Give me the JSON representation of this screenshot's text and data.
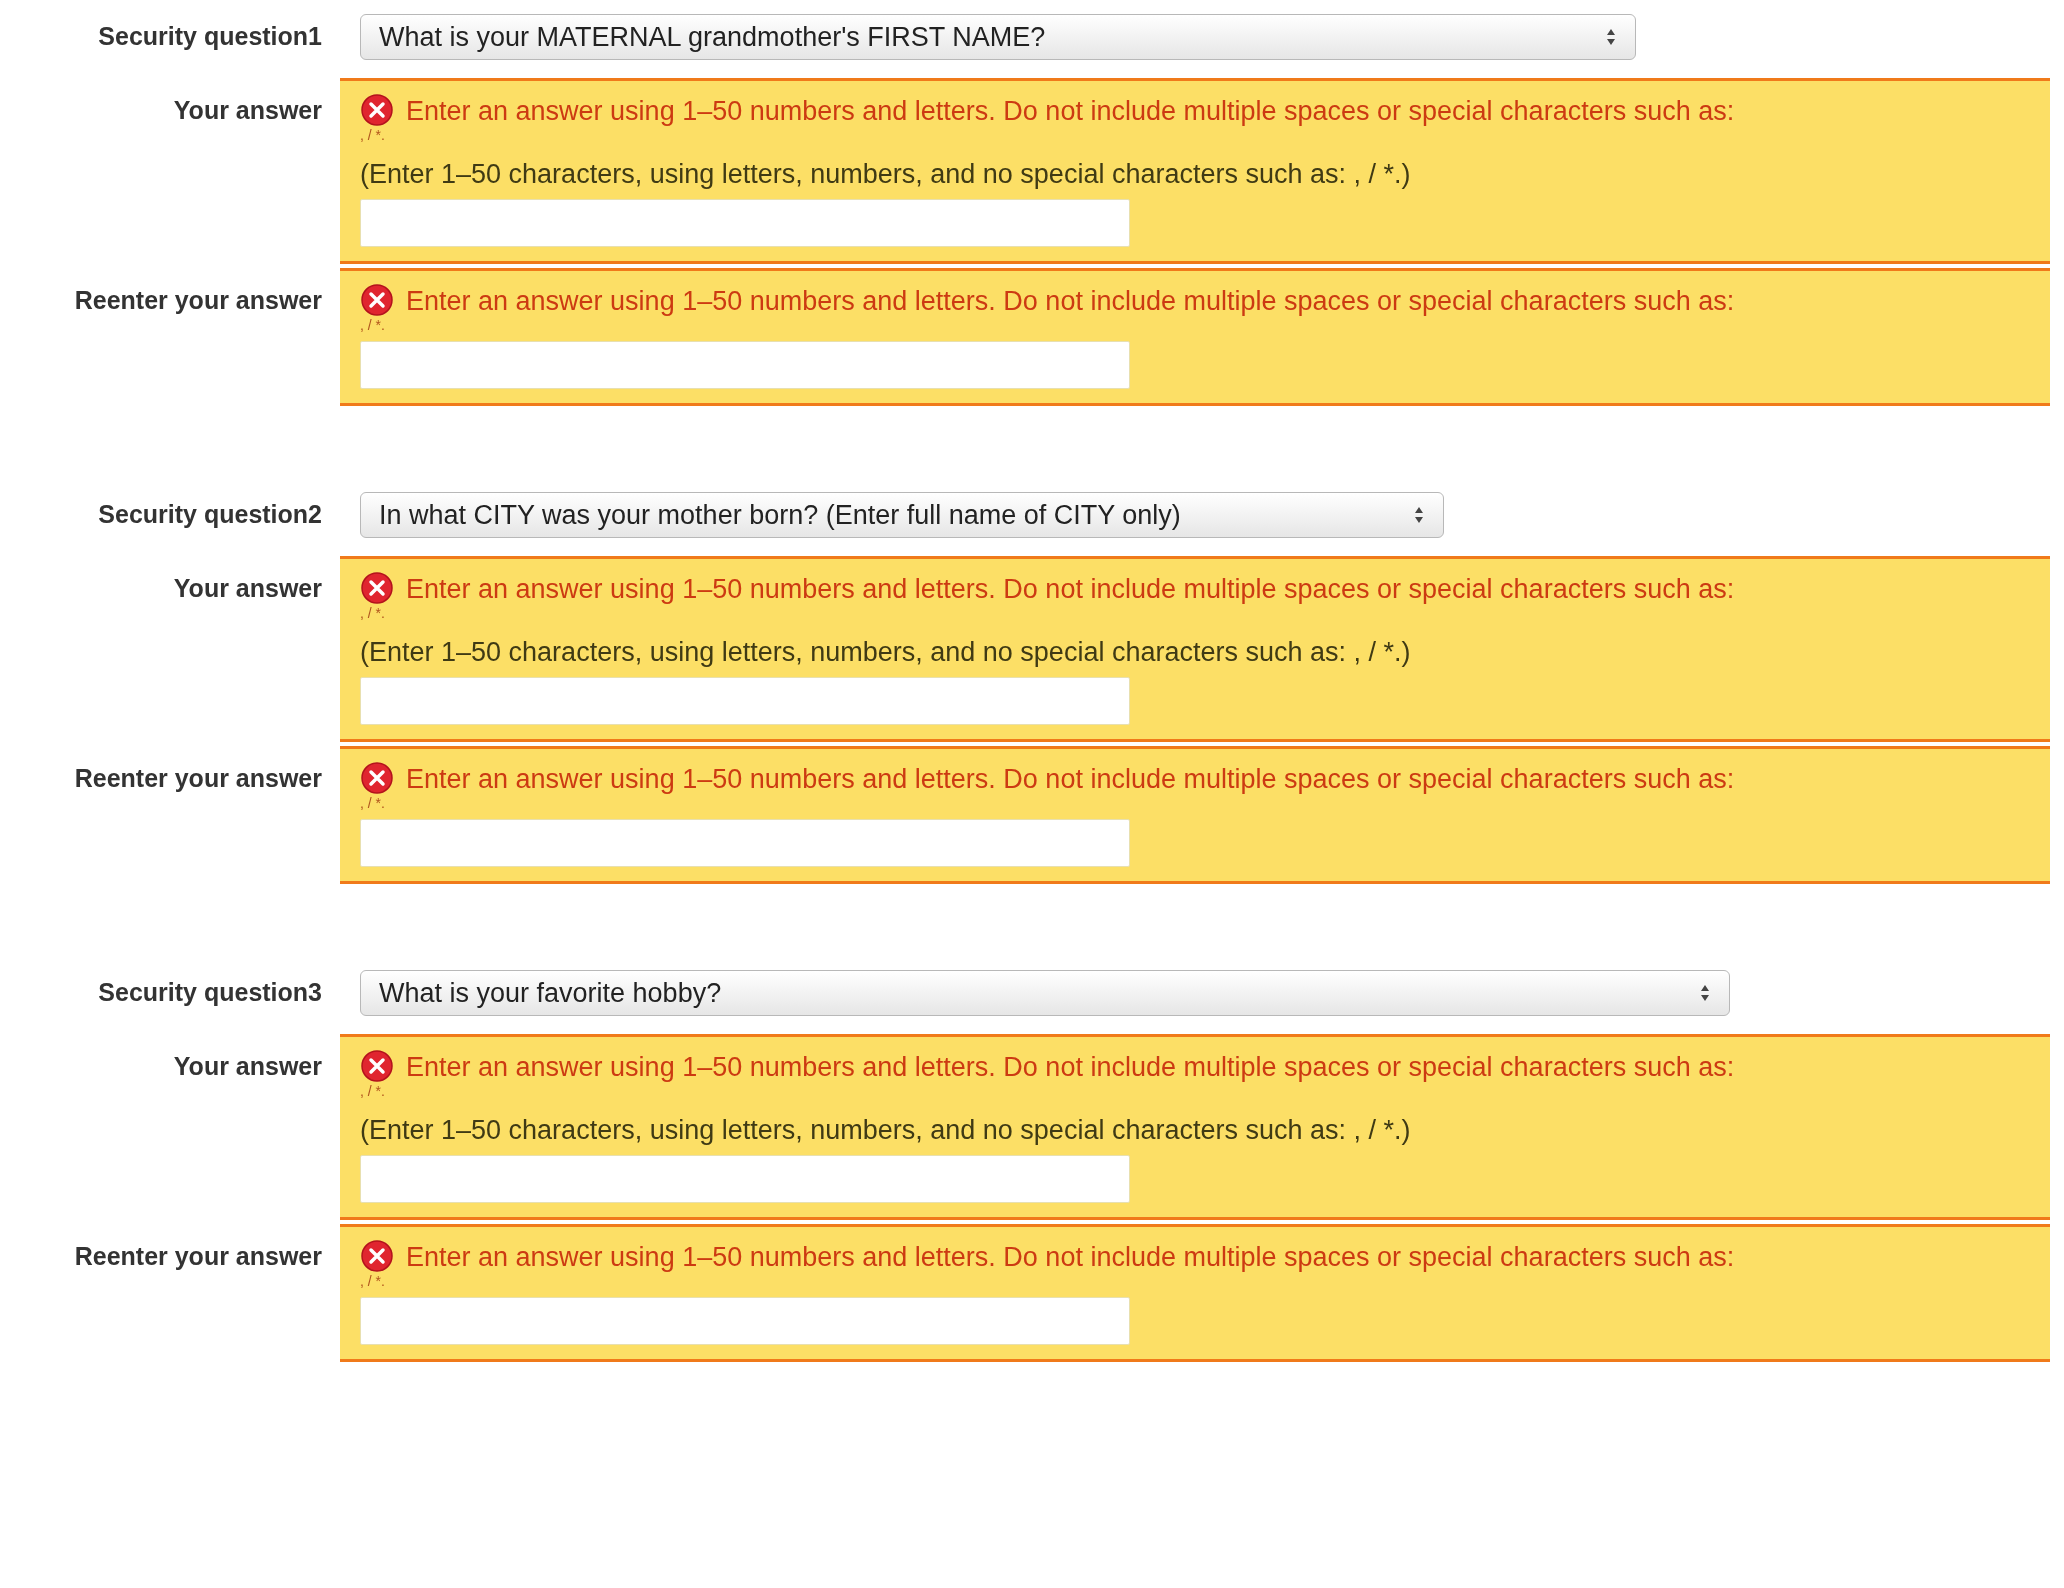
{
  "questions": [
    {
      "label": "Security question1",
      "question": "What is your MATERNAL grandmother's FIRST NAME?",
      "fields": [
        {
          "label": "Your answer",
          "invalid": true,
          "error": "Enter an answer using 1–50 numbers and letters. Do not include multiple spaces or special characters such as:",
          "overflow": ", / *.",
          "hint": "(Enter 1–50 characters, using letters, numbers, and no special characters such as: , / *.)"
        },
        {
          "label": "Reenter your answer",
          "invalid": true,
          "error": "Enter an answer using 1–50 numbers and letters. Do not include multiple spaces or special characters such as:",
          "overflow": ", / *."
        }
      ]
    },
    {
      "label": "Security question2",
      "question": "In what CITY was your mother born? (Enter full name of CITY only)",
      "fields": [
        {
          "label": "Your answer",
          "invalid": true,
          "error": "Enter an answer using 1–50 numbers and letters. Do not include multiple spaces or special characters such as:",
          "overflow": ", / *.",
          "hint": "(Enter 1–50 characters, using letters, numbers, and no special characters such as: , / *.)"
        },
        {
          "label": "Reenter your answer",
          "invalid": true,
          "error": "Enter an answer using 1–50 numbers and letters. Do not include multiple spaces or special characters such as:",
          "overflow": ", / *."
        }
      ]
    },
    {
      "label": "Security question3",
      "question": "What is your favorite hobby?",
      "fields": [
        {
          "label": "Your answer",
          "invalid": true,
          "error": "Enter an answer using 1–50 numbers and letters. Do not include multiple spaces or special characters such as:",
          "overflow": ", / *.",
          "hint": "(Enter 1–50 characters, using letters, numbers, and no special characters such as: , / *.)"
        },
        {
          "label": "Reenter your answer",
          "invalid": true,
          "error": "Enter an answer using 1–50 numbers and letters. Do not include multiple spaces or special characters such as:",
          "overflow": ", / *."
        }
      ]
    }
  ]
}
